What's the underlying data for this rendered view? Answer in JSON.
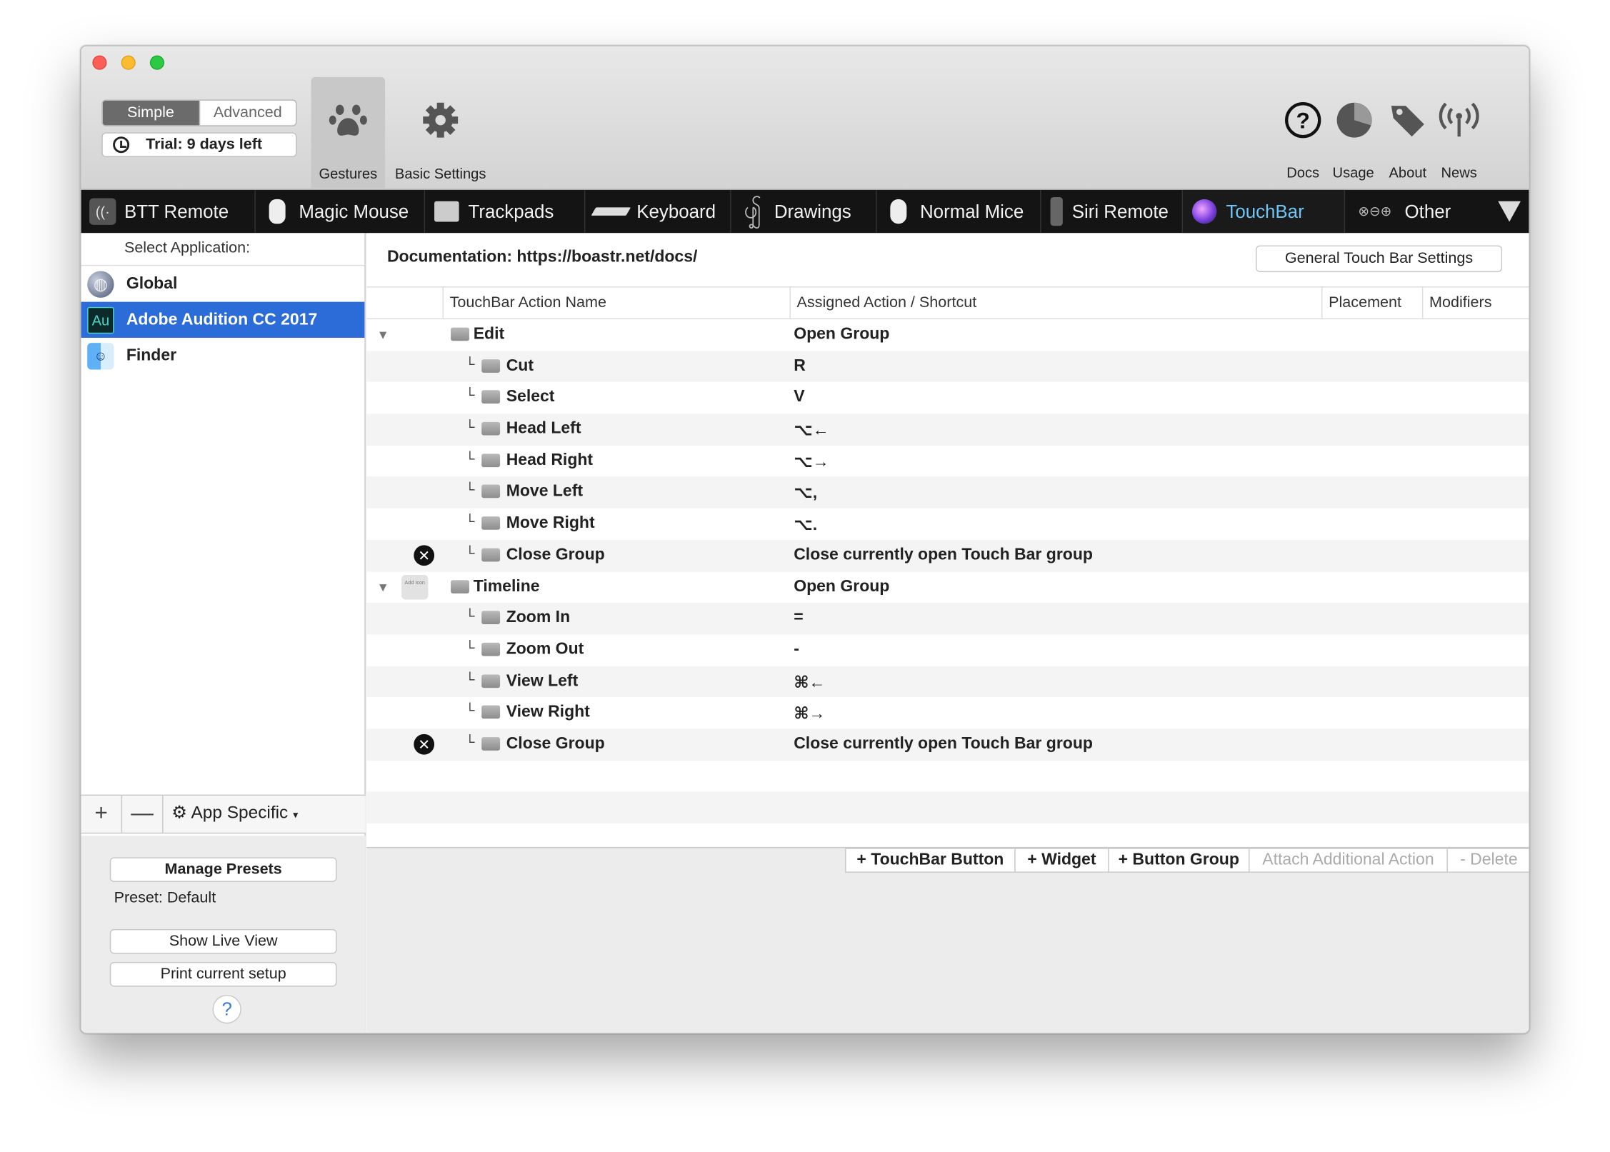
{
  "toolbar": {
    "mode_simple": "Simple",
    "mode_advanced": "Advanced",
    "trial": "Trial: 9 days left",
    "gestures": "Gestures",
    "basic_settings": "Basic Settings",
    "docs": "Docs",
    "usage": "Usage",
    "about": "About",
    "news": "News"
  },
  "tabs": [
    {
      "label": "BTT Remote",
      "icon": "btt-remote-icon"
    },
    {
      "label": "Magic Mouse",
      "icon": "magic-mouse-icon"
    },
    {
      "label": "Trackpads",
      "icon": "trackpad-icon"
    },
    {
      "label": "Keyboard",
      "icon": "keyboard-icon"
    },
    {
      "label": "Drawings",
      "icon": "drawings-icon"
    },
    {
      "label": "Normal Mice",
      "icon": "normal-mouse-icon"
    },
    {
      "label": "Siri Remote",
      "icon": "siri-remote-icon"
    },
    {
      "label": "TouchBar",
      "icon": "touchbar-icon",
      "active": true
    },
    {
      "label": "Other",
      "icon": "other-icon"
    }
  ],
  "sidebar": {
    "select_app_label": "Select Application:",
    "apps": [
      {
        "name": "Global",
        "icon": "globe-icon"
      },
      {
        "name": "Adobe Audition CC 2017",
        "icon": "audition-icon",
        "selected": true
      },
      {
        "name": "Finder",
        "icon": "finder-icon"
      }
    ],
    "add": "+",
    "remove": "—",
    "app_specific": "App Specific",
    "manage_presets": "Manage Presets",
    "preset": "Preset: Default",
    "show_live_view": "Show Live View",
    "print_setup": "Print current setup",
    "help": "?"
  },
  "main": {
    "documentation": "Documentation: https://boastr.net/docs/",
    "general_settings": "General Touch Bar Settings",
    "columns": [
      "TouchBar Action Name",
      "Assigned Action / Shortcut",
      "Placement",
      "Modifiers"
    ],
    "rows": [
      {
        "name": "Edit",
        "action": "Open Group",
        "level": 0,
        "expanded": true
      },
      {
        "name": "Cut",
        "action": "R",
        "level": 1
      },
      {
        "name": "Select",
        "action": "V",
        "level": 1
      },
      {
        "name": "Head Left",
        "action": "⌥←",
        "level": 1
      },
      {
        "name": "Head Right",
        "action": "⌥→",
        "level": 1
      },
      {
        "name": "Move Left",
        "action": "⌥,",
        "level": 1
      },
      {
        "name": "Move Right",
        "action": "⌥.",
        "level": 1
      },
      {
        "name": "Close Group",
        "action": "Close currently open Touch Bar group",
        "level": 1,
        "close": true
      },
      {
        "name": "Timeline",
        "action": "Open Group",
        "level": 0,
        "expanded": true,
        "icon_text": "Add Icon"
      },
      {
        "name": "Zoom In",
        "action": "=",
        "level": 1
      },
      {
        "name": "Zoom Out",
        "action": "-",
        "level": 1
      },
      {
        "name": "View Left",
        "action": "⌘←",
        "level": 1
      },
      {
        "name": "View Right",
        "action": "⌘→",
        "level": 1
      },
      {
        "name": "Close Group",
        "action": "Close currently open Touch Bar group",
        "level": 1,
        "close": true
      }
    ],
    "buttons": {
      "touchbar_button": "+ TouchBar Button",
      "widget": "+ Widget",
      "button_group": "+ Button Group",
      "attach": "Attach Additional Action",
      "delete": "- Delete"
    }
  }
}
